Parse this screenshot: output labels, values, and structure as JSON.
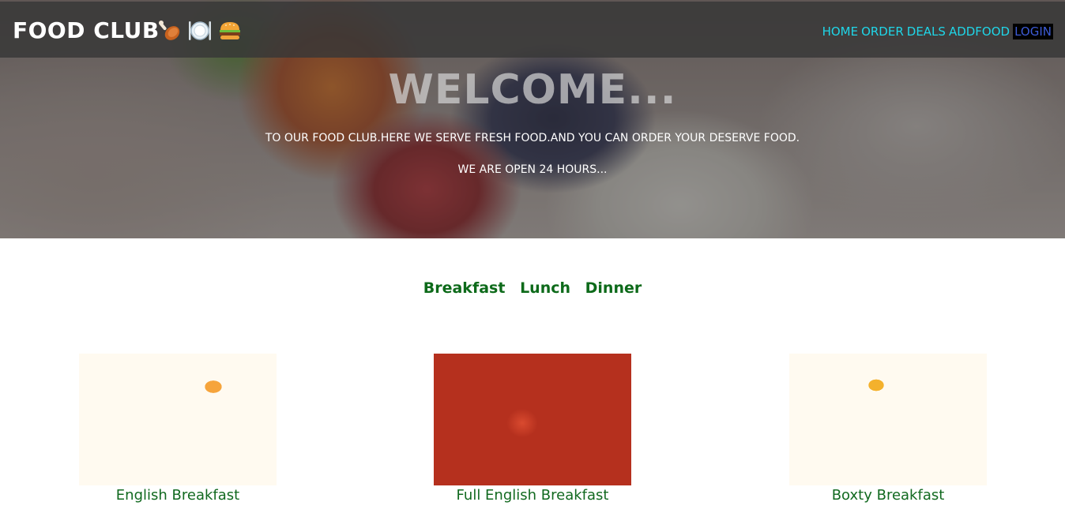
{
  "header": {
    "brand": "FOOD CLUB",
    "brand_icons": [
      "poultry-leg-icon",
      "plate-cutlery-icon",
      "burger-icon"
    ],
    "nav": {
      "home": "HOME",
      "order": "ORDER",
      "deals": "DEALS",
      "addfood": "ADDFOOD",
      "login": "LOGIN"
    }
  },
  "hero": {
    "title": "WELCOME...",
    "line1": "TO OUR FOOD CLUB.HERE WE SERVE FRESH FOOD.AND YOU CAN ORDER YOUR DESERVE FOOD.",
    "line2": "WE ARE OPEN 24 HOURS..."
  },
  "meals": {
    "tabs": [
      "Breakfast",
      "Lunch",
      "Dinner"
    ]
  },
  "cards": [
    {
      "title": "English Breakfast"
    },
    {
      "title": "Full English Breakfast"
    },
    {
      "title": "Boxty Breakfast"
    }
  ],
  "colors": {
    "nav_link": "#1fd6e8",
    "login_text": "#3d5bd6",
    "login_bg": "#000000",
    "accent_green": "#0d6a1a"
  }
}
